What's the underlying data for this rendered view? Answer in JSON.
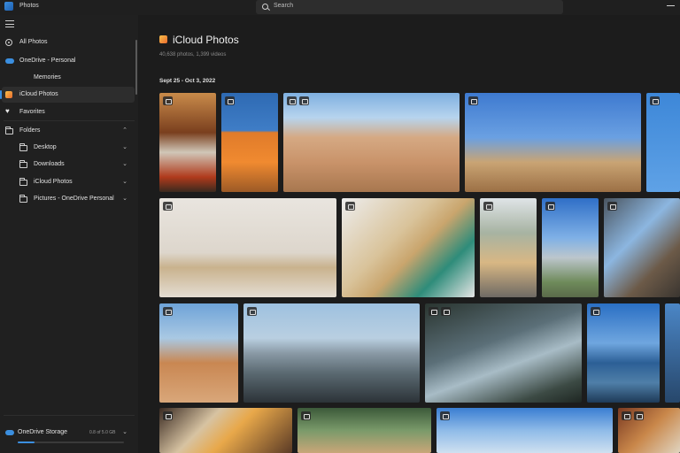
{
  "window": {
    "app_title": "Photos"
  },
  "search": {
    "placeholder": "Search"
  },
  "sidebar": {
    "items": [
      {
        "label": "All Photos",
        "icon": "all-photos-icon"
      },
      {
        "label": "OneDrive - Personal",
        "icon": "cloud-icon"
      },
      {
        "label": "Memories",
        "icon": ""
      },
      {
        "label": "iCloud Photos",
        "icon": "icloud-photos-icon",
        "selected": true
      },
      {
        "label": "Favorites",
        "icon": "heart-icon"
      },
      {
        "label": "Folders",
        "icon": "folder-icon"
      },
      {
        "label": "Desktop",
        "icon": "folder-icon"
      },
      {
        "label": "Downloads",
        "icon": "folder-icon"
      },
      {
        "label": "iCloud Photos",
        "icon": "folder-icon"
      },
      {
        "label": "Pictures - OneDrive Personal",
        "icon": "folder-icon"
      }
    ],
    "storage": {
      "label": "OneDrive Storage",
      "amount": "0.8 of 5.0 GB",
      "used_fraction": 0.16
    }
  },
  "main": {
    "title": "iCloud Photos",
    "subtitle": "40,638 photos, 1,399 videos",
    "date_range": "Sept 25 - Oct 3, 2022"
  },
  "colors": {
    "accent": "#3b8fe0",
    "background": "#1c1c1c",
    "sidebar": "#202020"
  }
}
